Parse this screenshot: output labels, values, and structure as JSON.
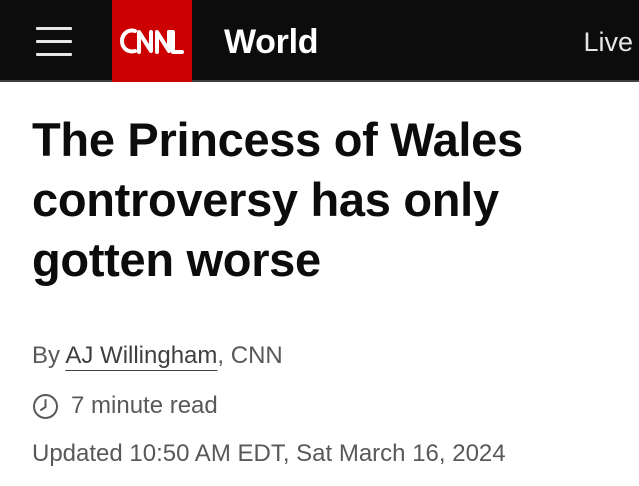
{
  "header": {
    "logo_text": "CNN",
    "section": "World",
    "live_label": "Live",
    "menu_icon": "hamburger-menu-icon",
    "brand_color": "#cc0000",
    "bar_color": "#0c0c0c"
  },
  "article": {
    "headline_line1": "The Princess of Wales",
    "headline_line2": "controversy has only",
    "headline_line3": "gotten worse",
    "byline_prefix": "By ",
    "author": "AJ Willingham",
    "byline_suffix": ", CNN",
    "read_time": "7 minute read",
    "read_time_icon": "clock-icon",
    "updated": "Updated 10:50 AM EDT, Sat March 16, 2024"
  }
}
